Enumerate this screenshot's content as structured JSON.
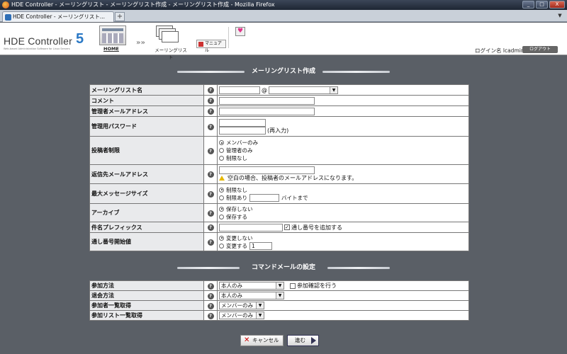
{
  "window": {
    "title": "HDE Controller - メーリングリスト - メーリングリスト作成 - メーリングリスト作成 - Mozilla Firefox",
    "buttons": [
      "_",
      "□",
      "X"
    ]
  },
  "tab": {
    "label": "HDE Controller - メーリングリスト...",
    "new_tab": "+"
  },
  "header": {
    "logo_text": "HDE Controller",
    "logo_number": "5",
    "logo_sub": "Web-based Administration Software for Linux Servers",
    "nav": [
      {
        "label": "HOME",
        "icon": "calendar-icon"
      },
      {
        "label": "メーリングリスト",
        "icon": "envelope-stack-icon"
      }
    ],
    "nav_arrow": "»»",
    "manual_label": "マニュアル",
    "favorite_icon": "heart-icon",
    "login_label": "ログイン名 lcadmin",
    "logout_label": "ログアウト"
  },
  "section1": {
    "title": "メーリングリスト作成",
    "rows": {
      "ml_name": {
        "label": "メーリングリスト名",
        "at": "@"
      },
      "comment": {
        "label": "コメント"
      },
      "admin_email": {
        "label": "管理者メールアドレス"
      },
      "admin_password": {
        "label": "管理用パスワード",
        "reenter": "(再入力)"
      },
      "poster_limit": {
        "label": "投稿者制限",
        "options": [
          "メンバーのみ",
          "管理者のみ",
          "制限なし"
        ],
        "selected": 0
      },
      "reply_to": {
        "label": "返信先メールアドレス",
        "note": "空白の場合、投稿者のメールアドレスになります。"
      },
      "max_size": {
        "label": "最大メッセージサイズ",
        "options": [
          "制限なし",
          "制限あり"
        ],
        "selected": 0,
        "unit": "バイトまで"
      },
      "archive": {
        "label": "アーカイブ",
        "options": [
          "保存しない",
          "保存する"
        ],
        "selected": 0
      },
      "subject_prefix": {
        "label": "件名プレフィックス",
        "checkbox_label": "通し番号を追加する",
        "checked": true
      },
      "serial_start": {
        "label": "通し番号開始値",
        "options": [
          "変更しない",
          "変更する"
        ],
        "selected": 0,
        "value": "1"
      }
    }
  },
  "section2": {
    "title": "コマンドメールの設定",
    "rows": {
      "join_method": {
        "label": "参加方法",
        "value": "本人のみ",
        "checkbox_label": "参加確認を行う",
        "checked": false
      },
      "leave_method": {
        "label": "退会方法",
        "value": "本人のみ"
      },
      "member_list": {
        "label": "参加者一覧取得",
        "value": "メンバーのみ"
      },
      "list_list": {
        "label": "参加リスト一覧取得",
        "value": "メンバーのみ"
      }
    }
  },
  "buttons": {
    "cancel": "キャンセル",
    "next": "進む"
  },
  "help_glyph": "?"
}
